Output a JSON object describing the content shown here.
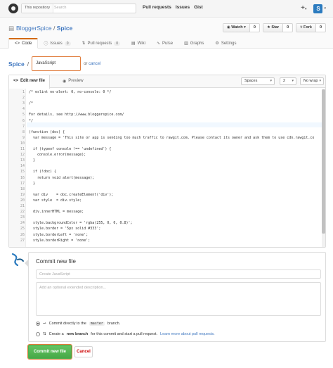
{
  "header": {
    "search_scope": "This repository",
    "search_placeholder": "Search",
    "nav": [
      "Pull requests",
      "Issues",
      "Gist"
    ],
    "avatar_letter": "S"
  },
  "repo": {
    "owner": "BloggerSpice",
    "name": "Spice",
    "watch_label": "Watch",
    "watch_count": "0",
    "star_label": "Star",
    "star_count": "0",
    "fork_label": "Fork",
    "fork_count": "0",
    "tabs": [
      {
        "label": "Code",
        "count": ""
      },
      {
        "label": "Issues",
        "count": "0"
      },
      {
        "label": "Pull requests",
        "count": "0"
      },
      {
        "label": "Wiki",
        "count": ""
      },
      {
        "label": "Pulse",
        "count": ""
      },
      {
        "label": "Graphs",
        "count": ""
      },
      {
        "label": "Settings",
        "count": ""
      }
    ]
  },
  "path": {
    "root": "Spice",
    "separator": "/",
    "filename": "JavaScript",
    "or": "or",
    "cancel": "cancel"
  },
  "editor": {
    "edit_tab": "Edit new file",
    "preview_tab": "Preview",
    "indent_mode": "Spaces",
    "indent_size": "2",
    "wrap_mode": "No wrap",
    "lines": [
      "/* eslint no-alert: 0, no-console: 0 */",
      "",
      "/*",
      "",
      "For details, see http://www.bloggerspice.com/",
      "*/",
      "",
      "(function (doc) {",
      "  var message = 'This site or app is sending too much traffic to rawgit.com. Please contact its owner and ask them to use cdn.rawgit.co",
      "",
      "  if (typeof console !== 'undefined') {",
      "    console.error(message);",
      "  }",
      "",
      "  if (!doc) {",
      "    return void alert(message);",
      "  }",
      "",
      "  var div    = doc.createElement('div');",
      "  var style  = div.style;",
      "",
      "  div.innerHTML = message;",
      "",
      "  style.backgroundColor = 'rgba(255, 0, 0, 0.8)';",
      "  style.border = '5px solid #333';",
      "  style.borderLeft = 'none';",
      "  style.borderRight = 'none';"
    ],
    "line_numbers": [
      "1",
      "2",
      "3",
      "4",
      "5",
      "6",
      "7",
      "8",
      "9",
      "10",
      "11",
      "12",
      "13",
      "14",
      "15",
      "16",
      "17",
      "18",
      "19",
      "20",
      "21",
      "22",
      "23",
      "24",
      "25",
      "26",
      "27"
    ]
  },
  "commit": {
    "title": "Commit new file",
    "summary_placeholder": "Create JavaScript",
    "description_placeholder": "Add an optional extended description...",
    "option_direct_pre": "Commit directly to the",
    "option_direct_branch": "master",
    "option_direct_post": "branch.",
    "option_new_pre": "Create a",
    "option_new_strong": "new branch",
    "option_new_post": "for this commit and start a pull request.",
    "option_new_link": "Learn more about pull requests.",
    "submit_label": "Commit new file",
    "cancel_label": "Cancel"
  },
  "colors": {
    "accent_orange": "#e07b3a",
    "link_blue": "#4078c0",
    "commit_green": "#47a847",
    "cancel_red": "#cc0000"
  }
}
